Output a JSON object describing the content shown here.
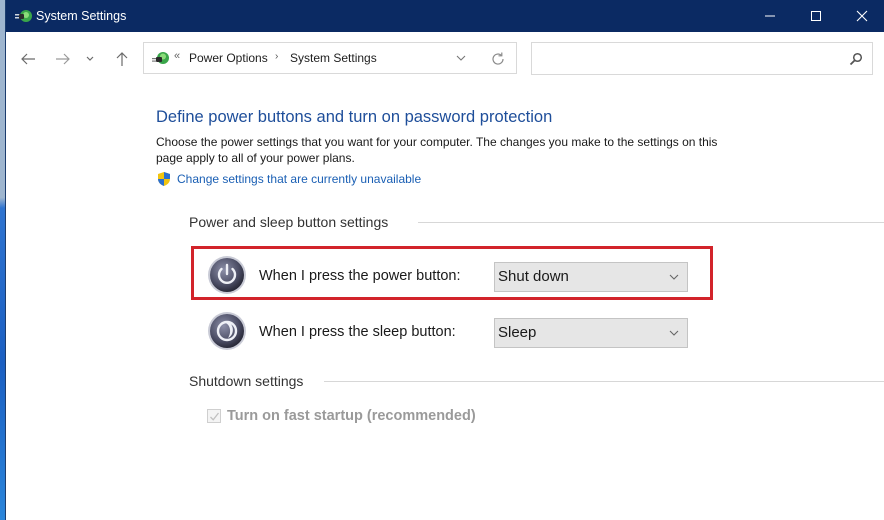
{
  "window": {
    "title": "System Settings",
    "controls": {
      "minimize": "minimize",
      "maximize": "maximize",
      "close": "close"
    }
  },
  "navigation": {
    "breadcrumb_overflow": "«",
    "breadcrumbs": [
      "Power Options",
      "System Settings"
    ],
    "breadcrumb_separator": "›",
    "search": {
      "value": "",
      "placeholder": ""
    }
  },
  "page": {
    "title": "Define power buttons and turn on password protection",
    "description": "Choose the power settings that you want for your computer. The changes you make to the settings on this page apply to all of your power plans.",
    "admin_link": "Change settings that are currently unavailable"
  },
  "power_sleep_group": {
    "label": "Power and sleep button settings",
    "rows": [
      {
        "label": "When I press the power button:",
        "icon": "power-button-icon",
        "value": "Shut down",
        "highlighted": true
      },
      {
        "label": "When I press the sleep button:",
        "icon": "sleep-button-icon",
        "value": "Sleep",
        "highlighted": false
      }
    ]
  },
  "shutdown_group": {
    "label": "Shutdown settings",
    "options": [
      {
        "label": "Turn on fast startup (recommended)",
        "checked": true,
        "disabled": true
      }
    ]
  },
  "colors": {
    "titlebar": "#0b2a63",
    "title_text": "#1e4e9a",
    "link": "#1a5fb4",
    "highlight_border": "#d2232a",
    "select_bg": "#e6e6e6"
  }
}
